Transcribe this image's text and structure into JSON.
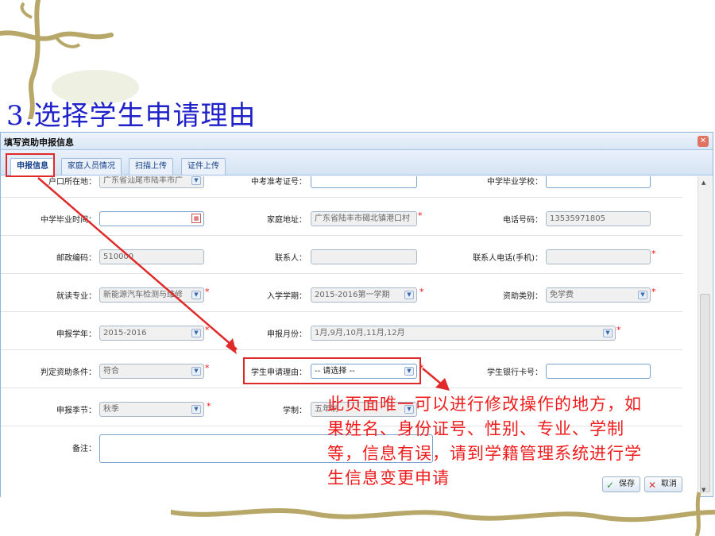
{
  "slide": {
    "title": "3.选择学生申请理由"
  },
  "dialog": {
    "title": "填写资助申报信息",
    "close_symbol": "✕"
  },
  "tabs": [
    {
      "label": "申报信息"
    },
    {
      "label": "家庭人员情况"
    },
    {
      "label": "扫描上传"
    },
    {
      "label": "证件上传"
    }
  ],
  "form": {
    "row1": {
      "residence_label": "户口所在地：",
      "residence_value": "广东省汕尾市陆丰市广",
      "exam_no_label": "中考准考证号：",
      "exam_no_value": "",
      "school_label": "中学毕业学校：",
      "school_value": ""
    },
    "row2": {
      "grad_time_label": "中学毕业时间：",
      "grad_time_value": "",
      "address_label": "家庭地址：",
      "address_value": "广东省陆丰市碣北镇港口村",
      "phone_label": "电话号码：",
      "phone_value": "13535971805"
    },
    "row3": {
      "postcode_label": "邮政编码：",
      "postcode_value": "510000",
      "contact_label": "联系人：",
      "contact_value": "",
      "contact_phone_label": "联系人电话(手机)：",
      "contact_phone_value": ""
    },
    "row4": {
      "major_label": "就读专业：",
      "major_value": "新能源汽车检测与维修",
      "term_label": "入学学期：",
      "term_value": "2015-2016第一学期",
      "aid_type_label": "资助类别：",
      "aid_type_value": "免学费"
    },
    "row5": {
      "year_label": "申报学年：",
      "year_value": "2015-2016",
      "months_label": "申报月份：",
      "months_value": "1月,9月,10月,11月,12月"
    },
    "row6": {
      "condition_label": "判定资助条件：",
      "condition_value": "符合",
      "reason_label": "学生申请理由：",
      "reason_value": "-- 请选择 --",
      "bank_label": "学生银行卡号：",
      "bank_value": ""
    },
    "row7": {
      "season_label": "申报季节：",
      "season_value": "秋季",
      "system_label": "学制：",
      "system_value": "五年制"
    },
    "row8": {
      "remark_label": "备注：",
      "remark_value": ""
    }
  },
  "buttons": {
    "save": "保存",
    "cancel": "取消"
  },
  "annotation": {
    "lines": [
      "此页面唯一可以进行修改操作的地方，如",
      "果姓名、身份证号、性别、专业、学制",
      "等，信息有误，请到学籍管理系统进行学",
      "生信息变更申请"
    ]
  },
  "colors": {
    "annotation_red": "#ee1c1c",
    "title_blue": "#1f22c8",
    "accent_border": "#8fb3d9"
  }
}
